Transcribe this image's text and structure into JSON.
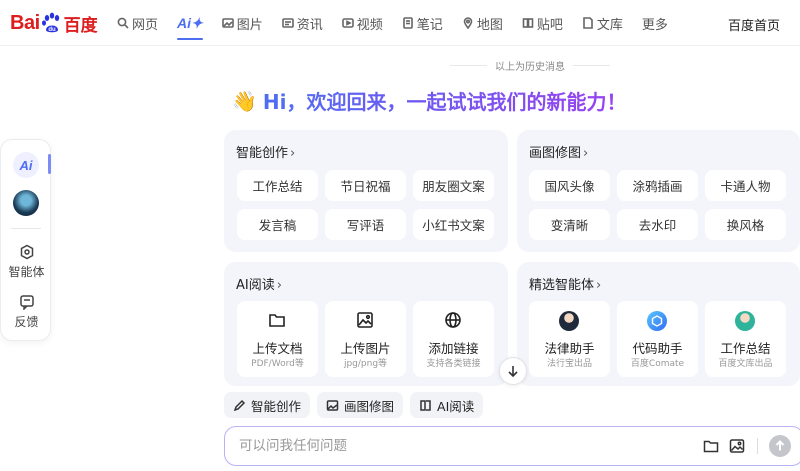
{
  "header": {
    "logo": {
      "part1": "Bai",
      "part2": "du",
      "part3": "百度"
    },
    "nav": [
      {
        "label": "网页",
        "icon": "search-icon"
      },
      {
        "label": "Ai✦",
        "icon": "ai-icon",
        "active": true
      },
      {
        "label": "图片",
        "icon": "image-icon"
      },
      {
        "label": "资讯",
        "icon": "news-icon"
      },
      {
        "label": "视频",
        "icon": "video-icon"
      },
      {
        "label": "笔记",
        "icon": "note-icon"
      },
      {
        "label": "地图",
        "icon": "map-icon"
      },
      {
        "label": "贴吧",
        "icon": "tieba-icon"
      },
      {
        "label": "文库",
        "icon": "library-icon"
      },
      {
        "label": "更多"
      }
    ],
    "home_link": "百度首页"
  },
  "rail": {
    "ai_label": "Ai",
    "agent_label": "智能体",
    "feedback_label": "反馈"
  },
  "main": {
    "history_label": "以上为历史消息",
    "greeting": "Hi，欢迎回来，一起试试我们的新能力！",
    "cards": {
      "create": {
        "title": "智能创作",
        "items": [
          "工作总结",
          "节日祝福",
          "朋友圈文案",
          "发言稿",
          "写评语",
          "小红书文案"
        ]
      },
      "image": {
        "title": "画图修图",
        "items": [
          "国风头像",
          "涂鸦插画",
          "卡通人物",
          "变清晰",
          "去水印",
          "换风格"
        ]
      },
      "read": {
        "title": "AI阅读",
        "items": [
          {
            "label": "上传文档",
            "sub": "PDF/Word等"
          },
          {
            "label": "上传图片",
            "sub": "jpg/png等"
          },
          {
            "label": "添加链接",
            "sub": "支持各类链接"
          }
        ]
      },
      "agents": {
        "title": "精选智能体",
        "items": [
          {
            "label": "法律助手",
            "sub": "法行宝出品"
          },
          {
            "label": "代码助手",
            "sub": "百度Comate"
          },
          {
            "label": "工作总结",
            "sub": "百度文库出品"
          }
        ]
      }
    },
    "chips": [
      "智能创作",
      "画图修图",
      "AI阅读"
    ],
    "input": {
      "placeholder": "可以问我任何问题",
      "value": ""
    }
  },
  "colors": {
    "accent": "#4e6ef2",
    "gradient_end": "#9b3ff0",
    "logo_red": "#de1e1e",
    "card_bg": "#f4f5fb"
  }
}
